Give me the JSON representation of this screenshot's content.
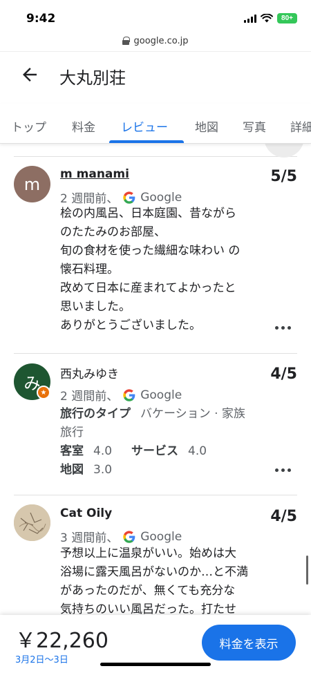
{
  "status_bar": {
    "time": "9:42",
    "battery": "80+"
  },
  "url_bar": {
    "domain": "google.co.jp",
    "icon": "lock-icon"
  },
  "header": {
    "title": "大丸別荘",
    "back_icon": "back-arrow-icon"
  },
  "tabs": [
    {
      "label": "トップ"
    },
    {
      "label": "料金"
    },
    {
      "label": "レビュー",
      "active": true
    },
    {
      "label": "地図"
    },
    {
      "label": "写真"
    },
    {
      "label": "詳細"
    }
  ],
  "reviews": [
    {
      "avatar_letter": "m",
      "avatar_color": "#8d6e63",
      "name": "m manami",
      "rating": "5/5",
      "time_ago": "2 週間前、",
      "source": "Google",
      "text": "桧の内風呂、日本庭園、昔ながら\nのたたみのお部屋、\n旬の食材を使った繊細な味わい の\n懐石料理。\n改めて日本に産まれてよかったと\n思いました。\nありがとうございました。"
    },
    {
      "avatar_letter": "み",
      "avatar_color": "#1e5631",
      "name": "西丸みゆき",
      "rating": "4/5",
      "time_ago": "2 週間前、",
      "source": "Google",
      "trip_type_label": "旅行のタイプ",
      "trip_type_value": "バケーション · 家族",
      "trip_type_value2": "旅行",
      "room_label": "客室",
      "room_value": "4.0",
      "service_label": "サービス",
      "service_value": "4.0",
      "map_label": "地図",
      "map_value": "3.0"
    },
    {
      "avatar_color": "#c9b9a0",
      "name": "Cat Oily",
      "rating": "4/5",
      "time_ago": "3 週間前、",
      "source": "Google",
      "text": "予想以上に温泉がいい。始めは大\n浴場に露天風呂がないのか…と不満\nがあったのだが、無くても充分な\n気持ちのいい風呂だった。打たせ"
    }
  ],
  "footer": {
    "price": "￥22,260",
    "dates": "3月2日〜3日",
    "cta_label": "料金を表示"
  },
  "colors": {
    "accent": "#1a73e8",
    "battery": "#34c759"
  }
}
